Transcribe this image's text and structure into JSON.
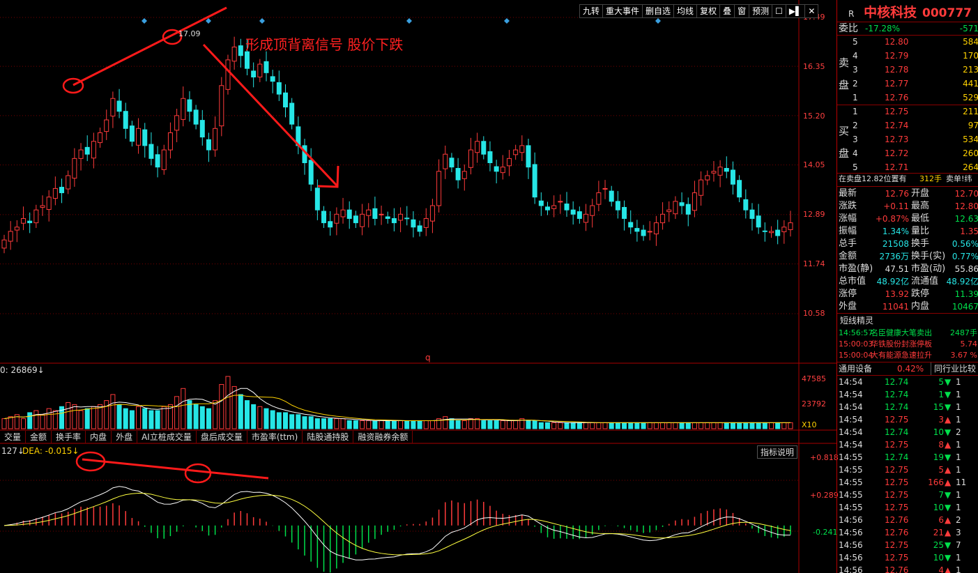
{
  "header": {
    "r_mark": "R",
    "stock_name": "中核科技",
    "stock_code": "000777"
  },
  "toolbar": [
    "九转",
    "重大事件",
    "删自选",
    "均线",
    "复权",
    "叠",
    "窗",
    "预测",
    "☐",
    "▶▌",
    "✕"
  ],
  "annotation": {
    "main_text": "形成顶背离信号 股价下跌",
    "peak_label": "17.09"
  },
  "price_axis": [
    "17.49",
    "16.35",
    "15.20",
    "14.05",
    "12.89",
    "11.74",
    "10.58"
  ],
  "volume": {
    "label": "0: 26869↓",
    "axis": [
      "47585",
      "23792"
    ],
    "scale": "X10"
  },
  "indicator_tabs": [
    "交量",
    "金额",
    "换手率",
    "内盘",
    "外盘",
    "AI立桩成交量",
    "盘后成交量",
    "市盈率(ttm)",
    "陆股通持股",
    "融资融券余额"
  ],
  "macd": {
    "label_a": "127↓",
    "label_b": "DEA: -0.015↓",
    "axis": [
      "+0.818",
      "+0.289",
      "-0.241"
    ],
    "explain_btn": "指标说明"
  },
  "misc_marker": "q",
  "order_book": {
    "webi_label": "委比",
    "webi_pct": "-17.28%",
    "webi_val": "-571",
    "sell_side_label": "卖盘",
    "buy_side_label": "买盘",
    "sell": [
      {
        "lvl": "5",
        "price": "12.80",
        "vol": "584"
      },
      {
        "lvl": "4",
        "price": "12.79",
        "vol": "170"
      },
      {
        "lvl": "3",
        "price": "12.78",
        "vol": "213"
      },
      {
        "lvl": "2",
        "price": "12.77",
        "vol": "441"
      },
      {
        "lvl": "1",
        "price": "12.76",
        "vol": "529"
      }
    ],
    "buy": [
      {
        "lvl": "1",
        "price": "12.75",
        "vol": "211"
      },
      {
        "lvl": "2",
        "price": "12.74",
        "vol": "97"
      },
      {
        "lvl": "3",
        "price": "12.73",
        "vol": "534"
      },
      {
        "lvl": "4",
        "price": "12.72",
        "vol": "260"
      },
      {
        "lvl": "5",
        "price": "12.71",
        "vol": "264"
      }
    ],
    "pending": "在卖盘12.82位置有",
    "pending_vol": "312手",
    "pending_right": "卖单!纬"
  },
  "quote": [
    {
      "l": "最新",
      "v": "12.76",
      "l2": "开盘",
      "v2": "12.70",
      "c1": "red",
      "c2": "red"
    },
    {
      "l": "涨跌",
      "v": "+0.11",
      "l2": "最高",
      "v2": "12.80",
      "c1": "red",
      "c2": "red"
    },
    {
      "l": "涨幅",
      "v": "+0.87%",
      "l2": "最低",
      "v2": "12.63",
      "c1": "red",
      "c2": "grn"
    },
    {
      "l": "振幅",
      "v": "1.34%",
      "l2": "量比",
      "v2": "1.35",
      "c1": "cyan",
      "c2": "red"
    },
    {
      "l": "总手",
      "v": "21508",
      "l2": "换手",
      "v2": "0.56%",
      "c1": "cyan",
      "c2": "cyan"
    },
    {
      "l": "金额",
      "v": "2736万",
      "l2": "换手(实)",
      "v2": "0.77%",
      "c1": "cyan",
      "c2": "cyan"
    },
    {
      "l": "市盈(静)",
      "v": "47.51",
      "l2": "市盈(动)",
      "v2": "55.86",
      "c1": "wht",
      "c2": "wht"
    },
    {
      "l": "总市值",
      "v": "48.92亿",
      "l2": "流通值",
      "v2": "48.92亿",
      "c1": "cyan",
      "c2": "cyan"
    },
    {
      "l": "涨停",
      "v": "13.92",
      "l2": "跌停",
      "v2": "11.39",
      "c1": "red",
      "c2": "grn"
    },
    {
      "l": "外盘",
      "v": "11041",
      "l2": "内盘",
      "v2": "10467",
      "c1": "red",
      "c2": "grn"
    }
  ],
  "short_news": {
    "title": "短线精灵",
    "items": [
      {
        "t": "14:56:57",
        "text": "名臣健康大笔卖出",
        "val": "2487手",
        "color": "grn"
      },
      {
        "t": "15:00:03",
        "text": "华铁股份封涨停板",
        "val": "5.74",
        "color": "red"
      },
      {
        "t": "15:00:04",
        "text": "大有能源急速拉升",
        "val": "3.67 %",
        "color": "red"
      }
    ]
  },
  "sector": {
    "name": "通用设备",
    "pct": "0.42%",
    "compare": "同行业比较"
  },
  "ticks": [
    {
      "t": "14:54",
      "p": "12.74",
      "v": "5",
      "d": "down",
      "x": "1"
    },
    {
      "t": "14:54",
      "p": "12.74",
      "v": "1",
      "d": "down",
      "x": "1"
    },
    {
      "t": "14:54",
      "p": "12.74",
      "v": "15",
      "d": "down",
      "x": "1"
    },
    {
      "t": "14:54",
      "p": "12.75",
      "v": "3",
      "d": "up",
      "x": "1"
    },
    {
      "t": "14:54",
      "p": "12.74",
      "v": "10",
      "d": "down",
      "x": "2"
    },
    {
      "t": "14:54",
      "p": "12.75",
      "v": "8",
      "d": "up",
      "x": "1"
    },
    {
      "t": "14:55",
      "p": "12.74",
      "v": "19",
      "d": "down",
      "x": "1"
    },
    {
      "t": "14:55",
      "p": "12.75",
      "v": "5",
      "d": "up",
      "x": "1"
    },
    {
      "t": "14:55",
      "p": "12.75",
      "v": "166",
      "d": "up",
      "x": "11"
    },
    {
      "t": "14:55",
      "p": "12.75",
      "v": "7",
      "d": "down",
      "x": "1"
    },
    {
      "t": "14:55",
      "p": "12.75",
      "v": "10",
      "d": "down",
      "x": "1"
    },
    {
      "t": "14:56",
      "p": "12.76",
      "v": "6",
      "d": "up",
      "x": "2"
    },
    {
      "t": "14:56",
      "p": "12.76",
      "v": "21",
      "d": "up",
      "x": "3"
    },
    {
      "t": "14:56",
      "p": "12.75",
      "v": "25",
      "d": "down",
      "x": "7"
    },
    {
      "t": "14:56",
      "p": "12.75",
      "v": "10",
      "d": "down",
      "x": "1"
    },
    {
      "t": "14:56",
      "p": "12.76",
      "v": "4",
      "d": "up",
      "x": "1"
    }
  ],
  "chart_data": {
    "type": "candlestick",
    "ylim": [
      10.0,
      17.49
    ],
    "peak_annotation": 17.09,
    "closes": [
      12.3,
      12.5,
      12.6,
      12.8,
      12.7,
      13.0,
      13.1,
      13.3,
      13.5,
      13.4,
      13.8,
      14.2,
      14.4,
      14.3,
      14.6,
      14.8,
      15.1,
      15.6,
      15.3,
      14.9,
      14.6,
      14.9,
      14.5,
      14.2,
      14.0,
      14.4,
      14.8,
      15.2,
      15.6,
      15.3,
      15.0,
      14.7,
      14.4,
      14.9,
      15.9,
      16.5,
      16.8,
      16.6,
      16.3,
      16.1,
      16.4,
      16.2,
      16.0,
      15.7,
      15.4,
      15.0,
      14.5,
      14.1,
      13.6,
      13.0,
      12.7,
      12.6,
      12.9,
      13.0,
      12.8,
      12.7,
      12.9,
      13.0,
      12.8,
      12.9,
      12.8,
      12.7,
      12.9,
      12.8,
      12.6,
      12.5,
      12.8,
      13.1,
      13.9,
      14.3,
      14.0,
      13.7,
      13.9,
      14.4,
      14.6,
      14.3,
      14.1,
      13.9,
      14.0,
      14.2,
      14.4,
      14.5,
      14.0,
      13.3,
      13.1,
      13.0,
      13.1,
      13.2,
      13.0,
      12.9,
      12.8,
      12.9,
      13.1,
      13.4,
      13.5,
      13.2,
      13.0,
      12.8,
      12.6,
      12.5,
      12.4,
      12.5,
      12.7,
      12.9,
      13.0,
      13.2,
      13.1,
      12.9,
      13.4,
      13.7,
      13.8,
      13.9,
      14.0,
      13.9,
      13.6,
      13.3,
      13.0,
      12.8,
      12.6,
      12.5,
      12.5,
      12.4,
      12.6,
      12.7
    ],
    "volumes": [
      5,
      6,
      7,
      5,
      8,
      9,
      7,
      10,
      9,
      11,
      13,
      12,
      9,
      10,
      11,
      12,
      14,
      17,
      12,
      10,
      9,
      11,
      10,
      9,
      9,
      11,
      12,
      16,
      20,
      14,
      12,
      11,
      10,
      14,
      22,
      26,
      21,
      17,
      14,
      12,
      11,
      10,
      9,
      8,
      8,
      7,
      7,
      6,
      6,
      5,
      5,
      5,
      5,
      5,
      4,
      4,
      4,
      4,
      4,
      4,
      4,
      4,
      4,
      4,
      4,
      4,
      4,
      4,
      5,
      6,
      5,
      4,
      4,
      5,
      5,
      4,
      4,
      4,
      4,
      4,
      4,
      5,
      4,
      4,
      3,
      3,
      3,
      3,
      3,
      3,
      3,
      3,
      3,
      3,
      3,
      3,
      3,
      3,
      3,
      3,
      3,
      3,
      3,
      3,
      3,
      3,
      3,
      3,
      3,
      3,
      3,
      3,
      3,
      3,
      3,
      3,
      3,
      3,
      3,
      3,
      3,
      3,
      3,
      3
    ],
    "macd_ylim": [
      -0.6,
      0.95
    ]
  }
}
